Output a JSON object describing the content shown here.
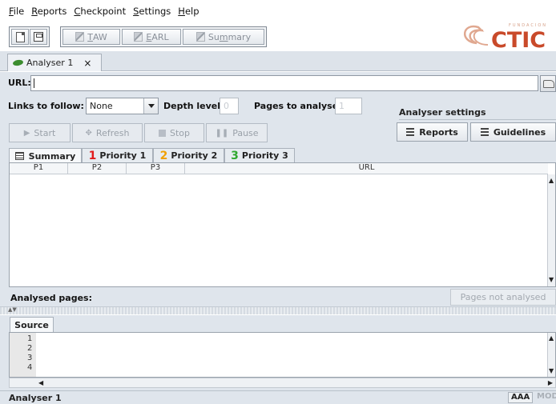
{
  "menu": {
    "items": [
      {
        "mnemonic": "F",
        "rest": "ile"
      },
      {
        "mnemonic": "R",
        "rest": "eports"
      },
      {
        "mnemonic": "C",
        "rest": "heckpoint"
      },
      {
        "mnemonic": "S",
        "rest": "ettings"
      },
      {
        "mnemonic": "H",
        "rest": "elp"
      }
    ]
  },
  "toolbar": {
    "new_icon": "new-document-icon",
    "save_icon": "save-icon",
    "taw": {
      "mnemonic": "T",
      "rest": "AW"
    },
    "earl": {
      "mnemonic": "E",
      "rest": "ARL"
    },
    "summary": {
      "pre": "Su",
      "mnemonic": "m",
      "rest": "mary"
    }
  },
  "logo": {
    "text": "CTIC",
    "subtext": "FUNDACION",
    "color": "#c94a2a"
  },
  "doc_tab": {
    "label": "Analyser 1",
    "close": "×"
  },
  "url": {
    "label": "URL:",
    "value": ""
  },
  "links": {
    "label": "Links to follow:",
    "selected": "None"
  },
  "depth": {
    "label": "Depth level:",
    "value": "0"
  },
  "pages": {
    "label": "Pages to analyse:",
    "value": "1"
  },
  "controls": {
    "start": "Start",
    "refresh": "Refresh",
    "stop": "Stop",
    "pause": "Pause"
  },
  "analyser_settings": {
    "title": "Analyser settings",
    "reports": "Reports",
    "guidelines": "Guidelines"
  },
  "result_tabs": {
    "summary": "Summary",
    "p1": {
      "num": "1",
      "label": "Priority 1",
      "color": "#e11b1b"
    },
    "p2": {
      "num": "2",
      "label": "Priority 2",
      "color": "#f0a000"
    },
    "p3": {
      "num": "3",
      "label": "Priority 3",
      "color": "#2fa82f"
    }
  },
  "table": {
    "columns": [
      "P1",
      "P2",
      "P3",
      "URL"
    ]
  },
  "analysed": {
    "label": "Analysed pages:",
    "not_analysed": "Pages not analysed"
  },
  "source": {
    "tab": "Source",
    "lines": [
      "1",
      "2",
      "3",
      "4"
    ]
  },
  "status": {
    "text": "Analyser 1",
    "level": "AAA",
    "mode": "MOD"
  }
}
